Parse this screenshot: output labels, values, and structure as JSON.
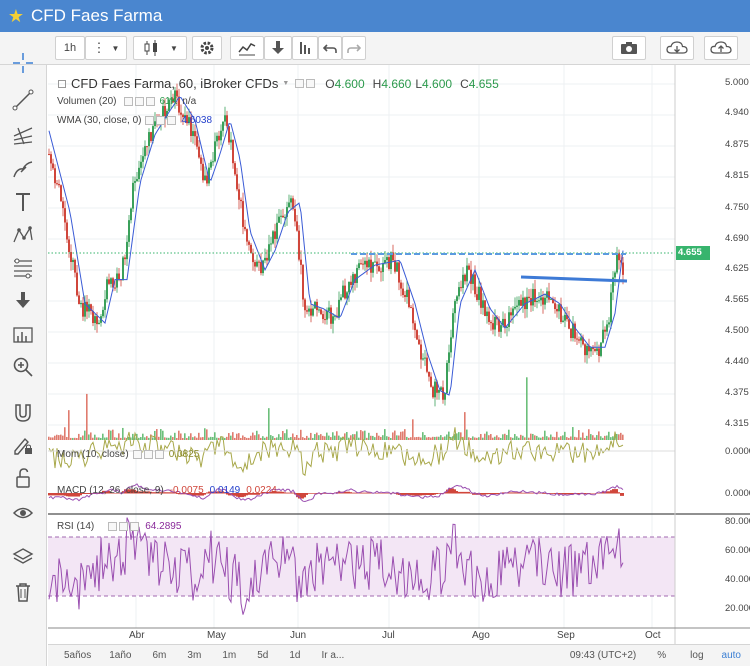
{
  "window": {
    "title": "CFD Faes Farma"
  },
  "toolbar": {
    "interval": "1h"
  },
  "legend": {
    "main_title": "CFD Faes Farma, 60, iBroker CFDs",
    "o_label": "O",
    "o_value": "4.600",
    "h_label": "H",
    "h_value": "4.660",
    "l_label": "L",
    "l_value": "4.600",
    "c_label": "C",
    "c_value": "4.655",
    "volume_label": "Volumen (20)",
    "volume_value": "61K",
    "volume_value2": "n/a",
    "wma_label": "WMA (30, close, 0)",
    "wma_value": "4.6038",
    "mom_label": "Mom (10, close)",
    "mom_value": "0.0825",
    "macd_label": "MACD (12, 26, close, 9)",
    "macd_v1": "-0.0075",
    "macd_v2": "0.0149",
    "macd_v3": "0.0224",
    "rsi_label": "RSI (14)",
    "rsi_value": "64.2895"
  },
  "price_axis": [
    "5.000",
    "4.940",
    "4.875",
    "4.815",
    "4.750",
    "4.690",
    "4.625",
    "4.565",
    "4.500",
    "4.440",
    "4.375",
    "4.315"
  ],
  "last_price": "4.655",
  "mom_axis": "0.0000",
  "macd_axis": "0.0000",
  "rsi_axis": [
    "80.0000",
    "60.0000",
    "40.0000",
    "20.0000"
  ],
  "time_axis": [
    "Abr",
    "May",
    "Jun",
    "Jul",
    "Ago",
    "Sep",
    "Oct"
  ],
  "bottom": {
    "ranges": [
      "5años",
      "1año",
      "6m",
      "3m",
      "1m",
      "5d",
      "1d",
      "Ir a..."
    ],
    "clock": "09:43 (UTC+2)",
    "pct": "%",
    "log": "log",
    "auto": "auto"
  },
  "colors": {
    "accent": "#4a86cf",
    "up": "#3aa05a",
    "down": "#d0463b",
    "wma": "#3a5bd6",
    "mom": "#a8a84a",
    "rsi": "#9a4fb0"
  }
}
